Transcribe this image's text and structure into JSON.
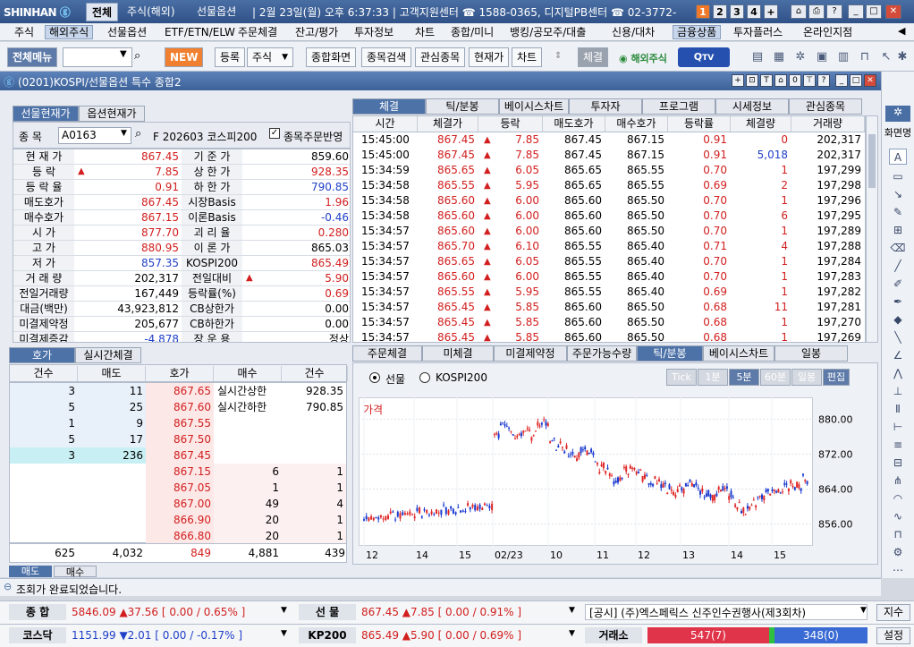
{
  "titlebar": {
    "logo": "SHINHAN",
    "tabs": [
      "전체",
      "주식(해외)",
      "선물옵션"
    ],
    "status": "| 2월 23일(월) 오후 6:37:33 | 고객지원센터 ☎ 1588-0365, 디지털PB센터 ☎ 02-3772-",
    "numbers": [
      "1",
      "2",
      "3",
      "4",
      "+"
    ],
    "win_btns": [
      "⌂",
      "⎙",
      "?",
      "_",
      "□",
      "✕"
    ]
  },
  "menubar": [
    "주식",
    "해외주식",
    "선물옵션",
    "ETF/ETN/ELW",
    "주문체결",
    "잔고/평가",
    "투자정보",
    "차트",
    "종합/미니",
    "뱅킹/공모주/대출",
    "신용/대차",
    "금융상품",
    "투자플러스",
    "온라인지점"
  ],
  "toolbar": {
    "all_menu": "전체메뉴",
    "new": "NEW",
    "register": "등록",
    "stock": "주식",
    "combined": "종합화면",
    "search": "종목검색",
    "watch": "관심종목",
    "price": "현재가",
    "chart": "차트",
    "conclude": "체결",
    "foreign": "해외주식",
    "tv": "TV"
  },
  "window": {
    "title": "(0201)KOSPI/선물옵션 특수 종합2",
    "btns": [
      "+",
      "⊡",
      "T",
      "⌂",
      "0",
      "⊤",
      "?",
      "_",
      "□",
      "✕"
    ]
  },
  "left": {
    "tabs": [
      "선물현재가",
      "옵션현재가"
    ],
    "code_label": "종 목",
    "code": "A0163",
    "name": "F 202603 코스피200",
    "check": "종목주문반영",
    "rows": [
      {
        "l1": "현 재 가",
        "v1": "867.45",
        "c1": "red",
        "l2": "기 준 가",
        "v2": "859.60",
        "c2": ""
      },
      {
        "l1": "등 락",
        "v1": "7.85",
        "c1": "red",
        "arrow": "▲",
        "l2": "상 한 가",
        "v2": "928.35",
        "c2": "red"
      },
      {
        "l1": "등 락 율",
        "v1": "0.91",
        "c1": "red",
        "l2": "하 한 가",
        "v2": "790.85",
        "c2": "blue"
      },
      {
        "l1": "매도호가",
        "v1": "867.45",
        "c1": "red",
        "l2": "시장Basis",
        "v2": "1.96",
        "c2": "red"
      },
      {
        "l1": "매수호가",
        "v1": "867.15",
        "c1": "red",
        "l2": "이론Basis",
        "v2": "-0.46",
        "c2": "blue"
      },
      {
        "l1": "시 가",
        "v1": "877.70",
        "c1": "red",
        "l2": "괴 리 율",
        "v2": "0.280",
        "c2": "red"
      },
      {
        "l1": "고 가",
        "v1": "880.95",
        "c1": "red",
        "l2": "이 론 가",
        "v2": "865.03",
        "c2": ""
      },
      {
        "l1": "저 가",
        "v1": "857.35",
        "c1": "blue",
        "l2": "KOSPI200",
        "v2": "865.49",
        "c2": "red"
      },
      {
        "l1": "거 래 량",
        "v1": "202,317",
        "c1": "",
        "l2": "전일대비",
        "v2": "5.90",
        "c2": "red",
        "arrow2": "▲"
      },
      {
        "l1": "전일거래량",
        "v1": "167,449",
        "c1": "",
        "l2": "등락률(%)",
        "v2": "0.69",
        "c2": "red"
      },
      {
        "l1": "대금(백만)",
        "v1": "43,923,812",
        "c1": "",
        "l2": "CB상한가",
        "v2": "0.00",
        "c2": ""
      },
      {
        "l1": "미결제약정",
        "v1": "205,677",
        "c1": "",
        "l2": "CB하한가",
        "v2": "0.00",
        "c2": ""
      },
      {
        "l1": "미결제증감",
        "v1": "-4,878",
        "c1": "blue",
        "l2": "장 운 용",
        "v2": "정상",
        "c2": ""
      }
    ]
  },
  "trades": {
    "tabs": [
      "체결",
      "틱/분봉",
      "베이시스차트",
      "투자자",
      "프로그램",
      "시세정보",
      "관심종목"
    ],
    "headers": [
      "시간",
      "체결가",
      "등락",
      "매도호가",
      "매수호가",
      "등락률",
      "체결량",
      "거래량"
    ],
    "rows": [
      [
        "15:45:00",
        "867.45",
        "7.85",
        "867.45",
        "867.15",
        "0.91",
        "0",
        "202,317"
      ],
      [
        "15:45:00",
        "867.45",
        "7.85",
        "867.45",
        "867.15",
        "0.91",
        "5,018",
        "202,317"
      ],
      [
        "15:34:59",
        "865.65",
        "6.05",
        "865.65",
        "865.55",
        "0.70",
        "1",
        "197,299"
      ],
      [
        "15:34:58",
        "865.55",
        "5.95",
        "865.65",
        "865.55",
        "0.69",
        "2",
        "197,298"
      ],
      [
        "15:34:58",
        "865.60",
        "6.00",
        "865.60",
        "865.50",
        "0.70",
        "1",
        "197,296"
      ],
      [
        "15:34:58",
        "865.60",
        "6.00",
        "865.60",
        "865.50",
        "0.70",
        "6",
        "197,295"
      ],
      [
        "15:34:57",
        "865.60",
        "6.00",
        "865.60",
        "865.50",
        "0.70",
        "1",
        "197,289"
      ],
      [
        "15:34:57",
        "865.70",
        "6.10",
        "865.55",
        "865.40",
        "0.71",
        "4",
        "197,288"
      ],
      [
        "15:34:57",
        "865.65",
        "6.05",
        "865.55",
        "865.40",
        "0.70",
        "1",
        "197,284"
      ],
      [
        "15:34:57",
        "865.60",
        "6.00",
        "865.55",
        "865.40",
        "0.70",
        "1",
        "197,283"
      ],
      [
        "15:34:57",
        "865.55",
        "5.95",
        "865.55",
        "865.40",
        "0.69",
        "1",
        "197,282"
      ],
      [
        "15:34:57",
        "865.45",
        "5.85",
        "865.60",
        "865.50",
        "0.68",
        "11",
        "197,281"
      ],
      [
        "15:34:57",
        "865.45",
        "5.85",
        "865.60",
        "865.50",
        "0.68",
        "1",
        "197,270"
      ],
      [
        "15:34:57",
        "865.45",
        "5.85",
        "865.60",
        "865.50",
        "0.68",
        "1",
        "197,269"
      ]
    ]
  },
  "orderbook": {
    "tabs": [
      "호가",
      "실시간체결"
    ],
    "headers": [
      "건수",
      "매도",
      "호가",
      "매수",
      "건수"
    ],
    "asks": [
      [
        "3",
        "11",
        "867.65"
      ],
      [
        "5",
        "25",
        "867.60"
      ],
      [
        "1",
        "9",
        "867.55"
      ],
      [
        "5",
        "17",
        "867.50"
      ],
      [
        "3",
        "236",
        "867.45"
      ]
    ],
    "bids": [
      [
        "867.15",
        "6",
        "1"
      ],
      [
        "867.05",
        "1",
        "1"
      ],
      [
        "867.00",
        "49",
        "4"
      ],
      [
        "866.90",
        "20",
        "1"
      ],
      [
        "866.80",
        "20",
        "1"
      ]
    ],
    "limits": [
      [
        "실시간상한",
        "928.35"
      ],
      [
        "실시간하한",
        "790.85"
      ]
    ],
    "totals": [
      "625",
      "4,032",
      "849",
      "4,881",
      "439"
    ]
  },
  "chartpanel": {
    "tabs": [
      "주문체결",
      "미체결",
      "미결제약정",
      "주문가능수량",
      "틱/분봉",
      "베이시스차트",
      "일봉"
    ],
    "radio1": "선물",
    "radio2": "KOSPI200",
    "period_btns": [
      "Tick",
      "1분",
      "5분",
      "60분",
      "일봉",
      "편집"
    ],
    "price_label": "가격"
  },
  "chart_data": {
    "type": "candlestick",
    "y_ticks": [
      "880.00",
      "872.00",
      "864.00",
      "856.00"
    ],
    "x_ticks": [
      "12",
      "14",
      "15",
      "02/23",
      "10",
      "11",
      "12",
      "13",
      "14",
      "15"
    ],
    "ylim": [
      851,
      885
    ]
  },
  "bottom_tabs": [
    "매도",
    "매수"
  ],
  "statusbar": {
    "msg": "조회가 완료되었습니다."
  },
  "bottom1": {
    "l1": "종 합",
    "v1": "5846.09 ▲37.56 [ 0.00 / 0.65% ]",
    "l2": "선 물",
    "v2": "867.45 ▲7.85 [ 0.00 / 0.91% ]",
    "news": "[공시] (주)엑스페릭스 신주인수권행사(제3회차)",
    "btn": "지수"
  },
  "bottom2": {
    "l1": "코스닥",
    "v1": "1151.99 ▼2.01 [ 0.00 / -0.17% ]",
    "l2": "KP200",
    "v2": "865.49 ▲5.90 [ 0.00 / 0.69% ]",
    "l3": "거래소",
    "sell": "547(7)",
    "buy": "348(0)",
    "btn": "설정"
  },
  "rightbar": {
    "label": "화면명"
  }
}
